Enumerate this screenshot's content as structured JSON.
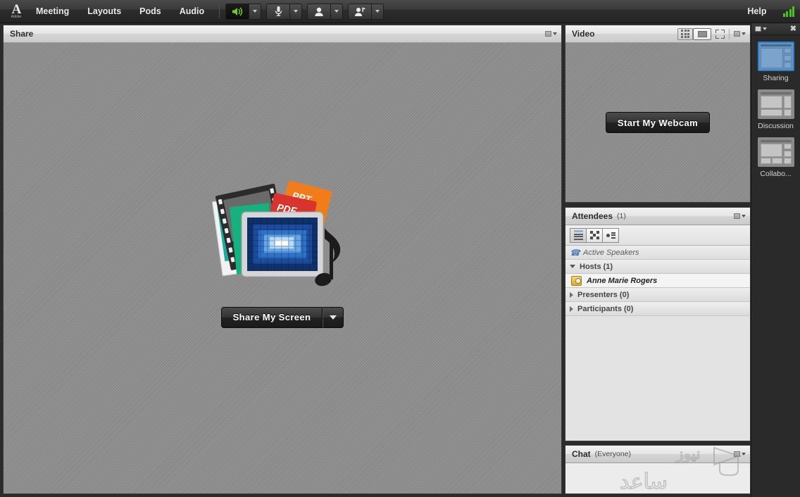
{
  "app": {
    "brand": "Adobe",
    "brand_mark": "A"
  },
  "menubar": {
    "items": [
      {
        "label": "Meeting",
        "name": "menu-meeting"
      },
      {
        "label": "Layouts",
        "name": "menu-layouts"
      },
      {
        "label": "Pods",
        "name": "menu-pods"
      },
      {
        "label": "Audio",
        "name": "menu-audio"
      }
    ],
    "controls": [
      {
        "name": "speaker-button",
        "icon": "speaker-icon",
        "state": "active"
      },
      {
        "name": "microphone-button",
        "icon": "microphone-icon",
        "state": "inactive"
      },
      {
        "name": "webcam-button",
        "icon": "webcam-person-icon",
        "state": "inactive"
      },
      {
        "name": "raise-hand-button",
        "icon": "raise-hand-icon",
        "state": "inactive"
      }
    ],
    "help_label": "Help",
    "connection": {
      "name": "connection-strength-icon",
      "bars": 4,
      "color": "#4cc417"
    }
  },
  "layoutbar": {
    "menu_icon": "pod-options-icon",
    "close_icon": "close-icon",
    "layouts": [
      {
        "label": "Sharing",
        "selected": true
      },
      {
        "label": "Discussion",
        "selected": false
      },
      {
        "label": "Collabo...",
        "selected": false
      }
    ]
  },
  "share_pod": {
    "title": "Share",
    "primary_button": "Share My Screen",
    "dropdown_icon": "chevron-down-icon",
    "menu_icon": "pod-options-icon",
    "art_name": "share-content-illustration"
  },
  "video_pod": {
    "title": "Video",
    "start_button": "Start My Webcam",
    "tools": [
      {
        "name": "grid-view-toggle",
        "icon": "grid-icon",
        "active": false
      },
      {
        "name": "filmstrip-view-toggle",
        "icon": "screen-icon",
        "active": true
      },
      {
        "name": "fullscreen-toggle",
        "icon": "fullscreen-icon",
        "active": false
      }
    ],
    "menu_icon": "pod-options-icon"
  },
  "attendees_pod": {
    "title": "Attendees",
    "count_label": "(1)",
    "menu_icon": "pod-options-icon",
    "toolbar": [
      {
        "name": "attendee-list-view-button",
        "icon": "list-view-icon",
        "active": true
      },
      {
        "name": "attendee-pods-view-button",
        "icon": "pods-view-icon",
        "active": false
      },
      {
        "name": "attendee-info-view-button",
        "icon": "contact-card-icon",
        "active": false
      }
    ],
    "rows": [
      {
        "type": "speakers",
        "label": "Active Speakers",
        "icon": "phone-icon"
      },
      {
        "type": "group",
        "label": "Hosts (1)",
        "expanded": true
      },
      {
        "type": "person",
        "label": "Anne Marie Rogers",
        "icon": "host-badge-icon"
      },
      {
        "type": "group",
        "label": "Presenters (0)",
        "expanded": false
      },
      {
        "type": "group",
        "label": "Participants (0)",
        "expanded": false
      }
    ]
  },
  "chat_pod": {
    "title": "Chat",
    "scope_label": "(Everyone)",
    "menu_icon": "pod-options-icon"
  },
  "watermark": {
    "line1": "نیوز",
    "line2": "ساعد"
  },
  "colors": {
    "accent_selected": "#2a7fd4",
    "signal_green": "#4cc417",
    "chrome_dark": "#2d2d2d",
    "pod_surface": "#d7d7d7"
  }
}
